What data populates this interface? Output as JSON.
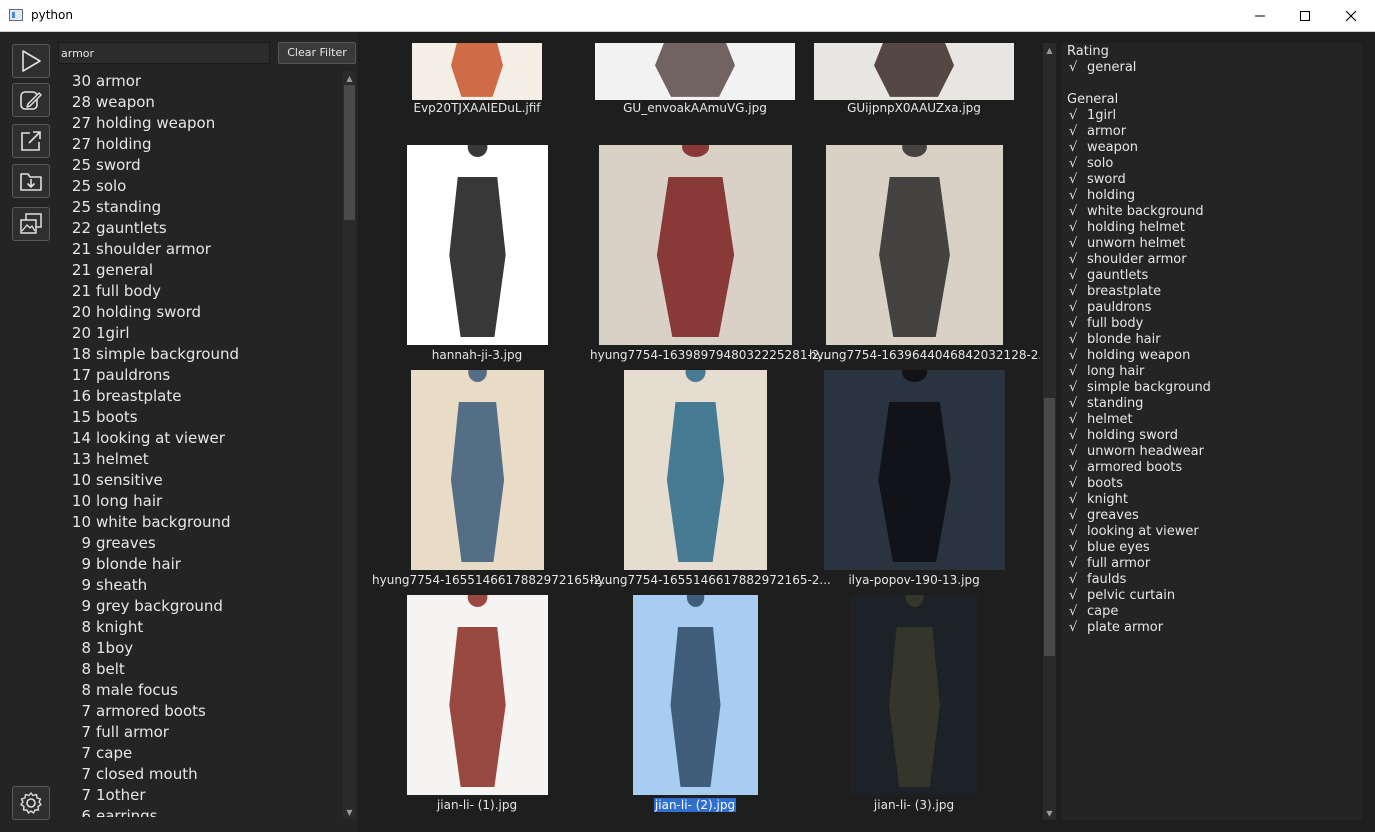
{
  "window": {
    "title": "python",
    "minimize": "—",
    "maximize": "☐",
    "close": "✕"
  },
  "toolbar": {
    "icons": [
      "play-icon",
      "edit-icon",
      "external-link-icon",
      "folder-download-icon",
      "images-icon"
    ],
    "settings_icon": "gear-icon"
  },
  "filter": {
    "value": "armor",
    "clear_label": "Clear Filter"
  },
  "tag_counts": [
    {
      "count": "30",
      "name": "armor"
    },
    {
      "count": "28",
      "name": "weapon"
    },
    {
      "count": "27",
      "name": "holding weapon"
    },
    {
      "count": "27",
      "name": "holding"
    },
    {
      "count": "25",
      "name": "sword"
    },
    {
      "count": "25",
      "name": "solo"
    },
    {
      "count": "25",
      "name": "standing"
    },
    {
      "count": "22",
      "name": "gauntlets"
    },
    {
      "count": "21",
      "name": "shoulder armor"
    },
    {
      "count": "21",
      "name": "general"
    },
    {
      "count": "21",
      "name": "full body"
    },
    {
      "count": "20",
      "name": "holding sword"
    },
    {
      "count": "20",
      "name": "1girl"
    },
    {
      "count": "18",
      "name": "simple background"
    },
    {
      "count": "17",
      "name": "pauldrons"
    },
    {
      "count": "16",
      "name": "breastplate"
    },
    {
      "count": "15",
      "name": "boots"
    },
    {
      "count": "14",
      "name": "looking at viewer"
    },
    {
      "count": "13",
      "name": "helmet"
    },
    {
      "count": "10",
      "name": "sensitive"
    },
    {
      "count": "10",
      "name": "long hair"
    },
    {
      "count": "10",
      "name": "white background"
    },
    {
      "count": "9",
      "name": "greaves"
    },
    {
      "count": "9",
      "name": "blonde hair"
    },
    {
      "count": "9",
      "name": "sheath"
    },
    {
      "count": "9",
      "name": "grey background"
    },
    {
      "count": "8",
      "name": "knight"
    },
    {
      "count": "8",
      "name": "1boy"
    },
    {
      "count": "8",
      "name": "belt"
    },
    {
      "count": "8",
      "name": "male focus"
    },
    {
      "count": "7",
      "name": "armored boots"
    },
    {
      "count": "7",
      "name": "full armor"
    },
    {
      "count": "7",
      "name": "cape"
    },
    {
      "count": "7",
      "name": "closed mouth"
    },
    {
      "count": "7",
      "name": "1other"
    },
    {
      "count": "6",
      "name": "earrings"
    }
  ],
  "images": [
    {
      "file": "Evp20TJXAAIEDuL.jfif",
      "bg": "#f4efe6",
      "fg": "#c8542a",
      "selected": false
    },
    {
      "file": "GU_envoakAAmuVG.jpg",
      "bg": "#f2f2f2",
      "fg": "#5a4a48",
      "selected": false
    },
    {
      "file": "GUijpnpX0AAUZxa.jpg",
      "bg": "#e8e6e2",
      "fg": "#3a2a28",
      "selected": false
    },
    {
      "file": "hannah-ji-3.jpg",
      "bg": "#ffffff",
      "fg": "#151515",
      "selected": false
    },
    {
      "file": "hyung7754-1639897948032225281-2...",
      "bg": "#d9d0c6",
      "fg": "#7a1e1e",
      "selected": false
    },
    {
      "file": "hyung7754-1639644046842032128-2...",
      "bg": "#d9d0c6",
      "fg": "#2a2a2a",
      "selected": false
    },
    {
      "file": "hyung7754-1655146617882972165-2...",
      "bg": "#e8dcc6",
      "fg": "#3a5a7a",
      "selected": false
    },
    {
      "file": "hyung7754-1655146617882972165-2...",
      "bg": "#e6ddd0",
      "fg": "#2a6a8a",
      "selected": false
    },
    {
      "file": "ilya-popov-190-13.jpg",
      "bg": "#2a3440",
      "fg": "#0e0e12",
      "selected": false
    },
    {
      "file": "jian-li- (1).jpg",
      "bg": "#f6f4f2",
      "fg": "#8a2a22",
      "selected": false
    },
    {
      "file": "jian-li- (2).jpg",
      "bg": "#a8cdf0",
      "fg": "#2e4a66",
      "selected": true
    },
    {
      "file": "jian-li- (3).jpg",
      "bg": "#1c2228",
      "fg": "#3a3a2a",
      "selected": false
    }
  ],
  "rating_section": {
    "title": "Rating",
    "tags": [
      "general"
    ]
  },
  "general_section": {
    "title": "General",
    "tags": [
      "1girl",
      "armor",
      "weapon",
      "solo",
      "sword",
      "holding",
      "white background",
      "holding helmet",
      "unworn helmet",
      "shoulder armor",
      "gauntlets",
      "breastplate",
      "pauldrons",
      "full body",
      "blonde hair",
      "holding weapon",
      "long hair",
      "simple background",
      "standing",
      "helmet",
      "holding sword",
      "unworn headwear",
      "armored boots",
      "boots",
      "knight",
      "greaves",
      "looking at viewer",
      "blue eyes",
      "full armor",
      "faulds",
      "pelvic curtain",
      "cape",
      "plate armor"
    ]
  },
  "check_mark": "√",
  "colors": {
    "background": "#1e1e1e",
    "panel": "#242424",
    "selection": "#2f6fd0",
    "text": "#e6e6e6"
  }
}
